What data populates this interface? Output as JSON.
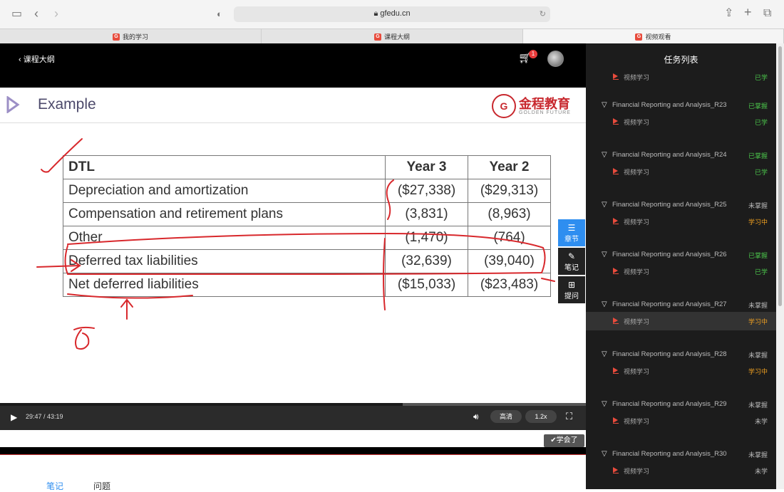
{
  "browser": {
    "url": "gfedu.cn",
    "tabs": [
      {
        "label": "我的学习"
      },
      {
        "label": "课程大纲"
      },
      {
        "label": "视频观看"
      }
    ]
  },
  "player": {
    "back_label": "课程大纲",
    "cart_count": "1",
    "slide": {
      "title": "Example",
      "brand_cn": "金程教育",
      "brand_en": "GOLDEN FUTURE",
      "table": {
        "headers": [
          "DTL",
          "Year 3",
          "Year 2"
        ],
        "rows": [
          [
            "Depreciation and amortization",
            "($27,338)",
            "($29,313)"
          ],
          [
            "Compensation and retirement plans",
            "(3,831)",
            "(8,963)"
          ],
          [
            "Other",
            "(1,470)",
            "(764)"
          ],
          [
            "Deferred tax liabilities",
            "(32,639)",
            "(39,040)"
          ],
          [
            "Net deferred liabilities",
            "($15,033)",
            "($23,483)"
          ]
        ]
      }
    },
    "side_tools": [
      {
        "label": "章节",
        "icon": "list-icon"
      },
      {
        "label": "笔记",
        "icon": "pencil-icon"
      },
      {
        "label": "提问",
        "icon": "question-icon"
      }
    ],
    "controls": {
      "time": "29:47 / 43:19",
      "progress": 0.687,
      "quality": "高清",
      "speed": "1.2x"
    },
    "learned_button": "✔学会了"
  },
  "bottom_tabs": [
    {
      "label": "笔记",
      "active": true
    },
    {
      "label": "问题",
      "active": false
    }
  ],
  "task_panel": {
    "title": "任务列表",
    "entries": [
      {
        "kind": "item",
        "label": "视频学习",
        "status": "已学",
        "color": "green"
      },
      {
        "kind": "chapter",
        "label": "Financial Reporting and Analysis_R23",
        "status": "已掌握",
        "color": "green"
      },
      {
        "kind": "item",
        "label": "视频学习",
        "status": "已学",
        "color": "green"
      },
      {
        "kind": "chapter",
        "label": "Financial Reporting and Analysis_R24",
        "status": "已掌握",
        "color": "green"
      },
      {
        "kind": "item",
        "label": "视频学习",
        "status": "已学",
        "color": "green"
      },
      {
        "kind": "chapter",
        "label": "Financial Reporting and Analysis_R25",
        "status": "未掌握",
        "color": "gray"
      },
      {
        "kind": "item",
        "label": "视频学习",
        "status": "学习中",
        "color": "orange"
      },
      {
        "kind": "chapter",
        "label": "Financial Reporting and Analysis_R26",
        "status": "已掌握",
        "color": "green"
      },
      {
        "kind": "item",
        "label": "视频学习",
        "status": "已学",
        "color": "green"
      },
      {
        "kind": "chapter",
        "label": "Financial Reporting and Analysis_R27",
        "status": "未掌握",
        "color": "gray"
      },
      {
        "kind": "item",
        "label": "视频学习",
        "status": "学习中",
        "color": "orange",
        "current": true
      },
      {
        "kind": "chapter",
        "label": "Financial Reporting and Analysis_R28",
        "status": "未掌握",
        "color": "gray"
      },
      {
        "kind": "item",
        "label": "视频学习",
        "status": "学习中",
        "color": "orange"
      },
      {
        "kind": "chapter",
        "label": "Financial Reporting and Analysis_R29",
        "status": "未掌握",
        "color": "gray"
      },
      {
        "kind": "item",
        "label": "视频学习",
        "status": "未学",
        "color": "gray"
      },
      {
        "kind": "chapter",
        "label": "Financial Reporting and Analysis_R30",
        "status": "未掌握",
        "color": "gray"
      },
      {
        "kind": "item",
        "label": "视频学习",
        "status": "未学",
        "color": "gray"
      }
    ]
  }
}
